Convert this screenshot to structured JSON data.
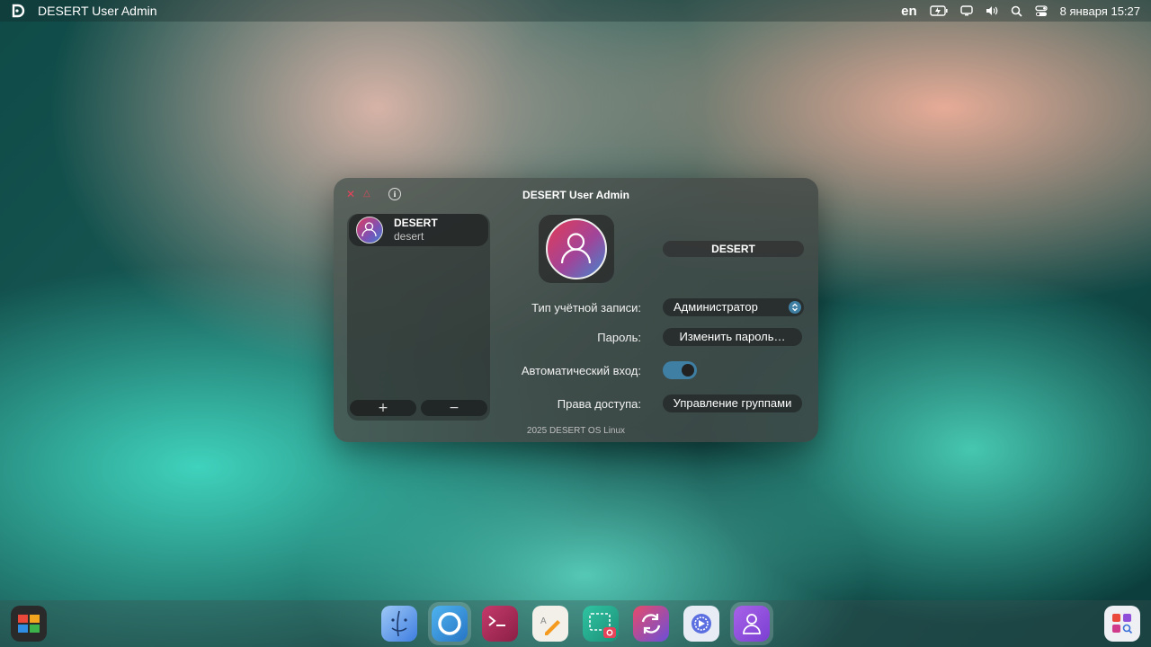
{
  "topbar": {
    "app_title": "DESERT User Admin",
    "lang": "en",
    "datetime": "8 января 15:27"
  },
  "window": {
    "title": "DESERT User Admin",
    "close_glyph": "✕",
    "minimize_glyph": "△",
    "info_glyph": "i",
    "users": [
      {
        "name": "DESERT",
        "login": "desert"
      }
    ],
    "add_glyph": "+",
    "remove_glyph": "−",
    "name_field": "DESERT",
    "account_type_label": "Тип учётной записи:",
    "account_type_value": "Администратор",
    "password_label": "Пароль:",
    "password_button": "Изменить пароль…",
    "autologin_label": "Автоматический вход:",
    "autologin_enabled": true,
    "access_label": "Права доступа:",
    "access_button": "Управление группами",
    "footer": "2025 DESERT OS Linux"
  },
  "dock": {
    "items": [
      "start-menu-icon",
      "finder-icon",
      "browser-icon",
      "terminal-icon",
      "text-editor-icon",
      "screenshot-icon",
      "sync-icon",
      "settings-icon",
      "user-admin-icon",
      "app-grid-icon"
    ]
  },
  "colors": {
    "accent": "#3f7fa3",
    "close": "#e6435a"
  }
}
